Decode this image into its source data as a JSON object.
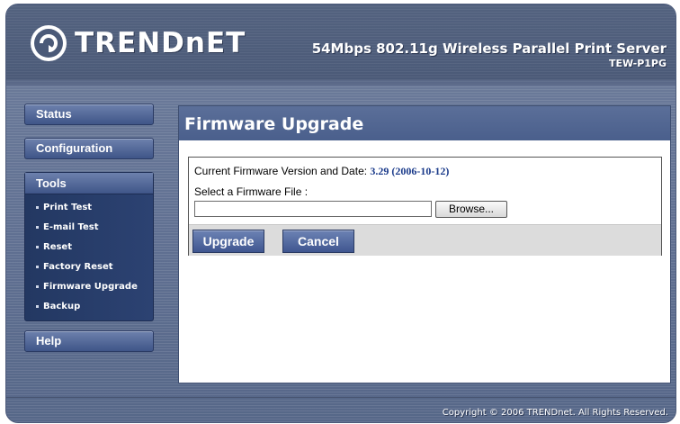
{
  "header": {
    "brand": "TRENDnET",
    "product_name": "54Mbps 802.11g Wireless Parallel Print Server",
    "model": "TEW-P1PG"
  },
  "sidebar": {
    "status_label": "Status",
    "configuration_label": "Configuration",
    "tools": {
      "title": "Tools",
      "items": [
        {
          "label": "Print Test"
        },
        {
          "label": "E-mail Test"
        },
        {
          "label": "Reset"
        },
        {
          "label": "Factory Reset"
        },
        {
          "label": "Firmware Upgrade"
        },
        {
          "label": "Backup"
        }
      ]
    },
    "help_label": "Help"
  },
  "main": {
    "title": "Firmware Upgrade",
    "firmware_label": "Current Firmware Version and Date:",
    "firmware_value": "3.29 (2006-10-12)",
    "select_label": "Select a Firmware File :",
    "file_value": "",
    "browse_label": "Browse...",
    "upgrade_label": "Upgrade",
    "cancel_label": "Cancel"
  },
  "footer": {
    "copyright": "Copyright © 2006 TRENDnet. All Rights Reserved."
  },
  "colors": {
    "frame": "#5f6f91",
    "nav_dark": "#233862",
    "accent_blue": "#1a3a8a",
    "button_bar": "#dcdcdc"
  }
}
